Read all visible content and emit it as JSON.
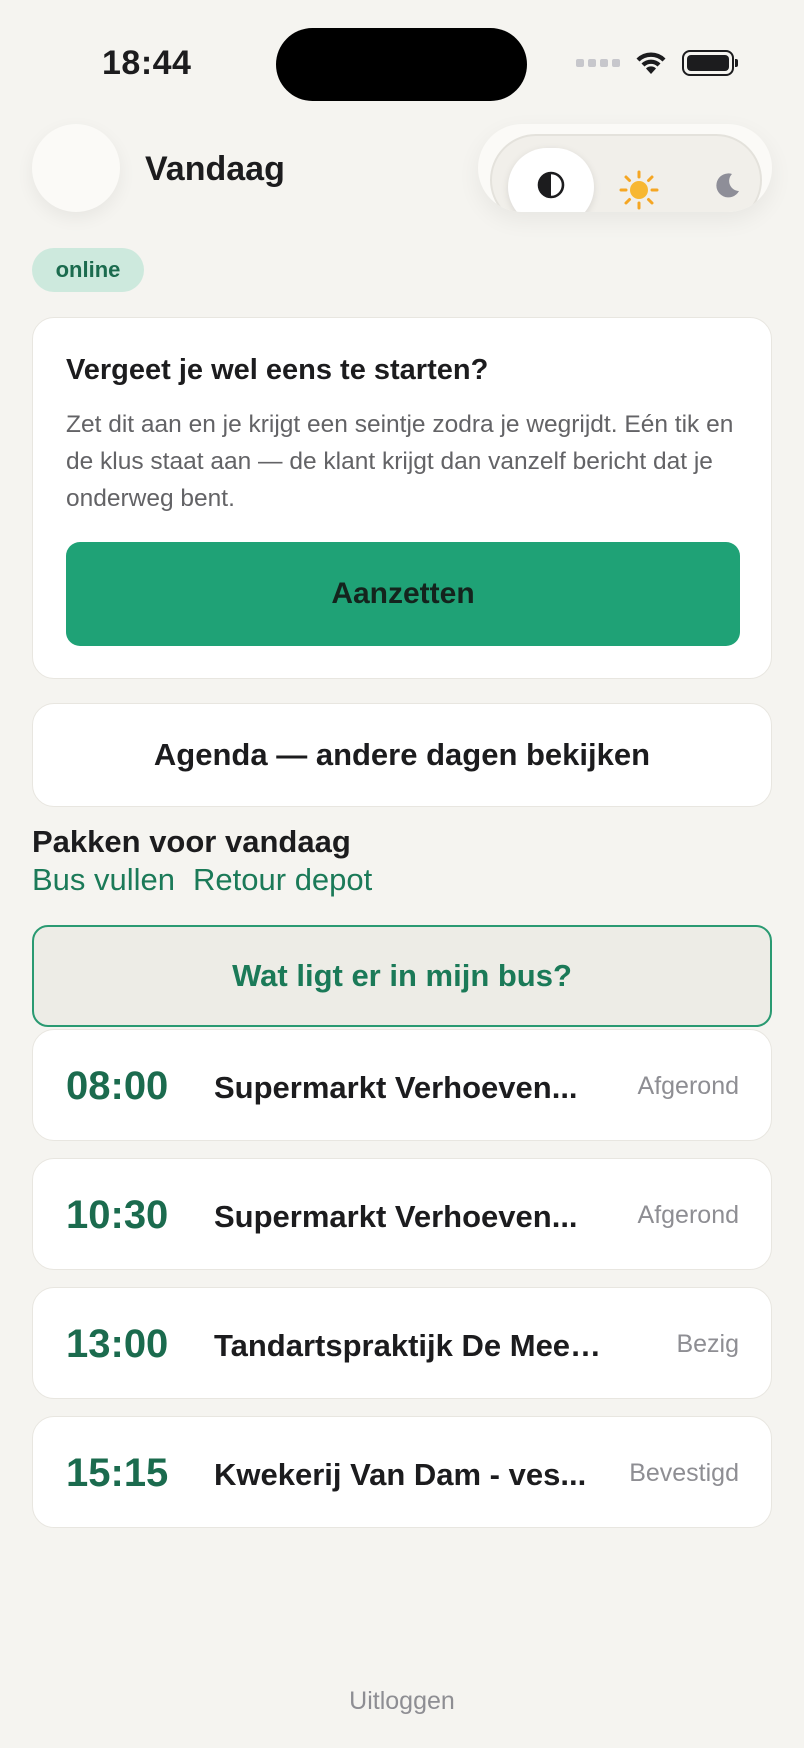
{
  "status_bar": {
    "time": "18:44"
  },
  "header": {
    "title": "Vandaag"
  },
  "theme_toggle": {
    "options": [
      "auto",
      "light",
      "dark"
    ],
    "selected": "auto"
  },
  "status_badge": "online",
  "intro": {
    "title": "Vergeet je wel eens te starten?",
    "body": "Zet dit aan en je krijgt een seintje zodra je wegrijdt. Eén tik en de klus staat aan — de klant krijgt dan vanzelf bericht dat je onderweg bent.",
    "button_label": "Aanzetten"
  },
  "agenda_button": "Agenda — andere dagen bekijken",
  "packing": {
    "title": "Pakken voor vandaag",
    "links": [
      "Bus vullen",
      "Retour depot"
    ],
    "bus_button": "Wat ligt er in mijn bus?"
  },
  "jobs": [
    {
      "time": "08:00",
      "name": "Supermarkt Verhoeven...",
      "status": "Afgerond"
    },
    {
      "time": "10:30",
      "name": "Supermarkt Verhoeven...",
      "status": "Afgerond"
    },
    {
      "time": "13:00",
      "name": "Tandartspraktijk De Meern...",
      "status": "Bezig"
    },
    {
      "time": "15:15",
      "name": "Kwekerij Van Dam - ves...",
      "status": "Bevestigd"
    }
  ],
  "logout_label": "Uitloggen",
  "colors": {
    "accent": "#1fa276",
    "accent_text": "#1b7a58",
    "background": "#f5f4f0"
  }
}
